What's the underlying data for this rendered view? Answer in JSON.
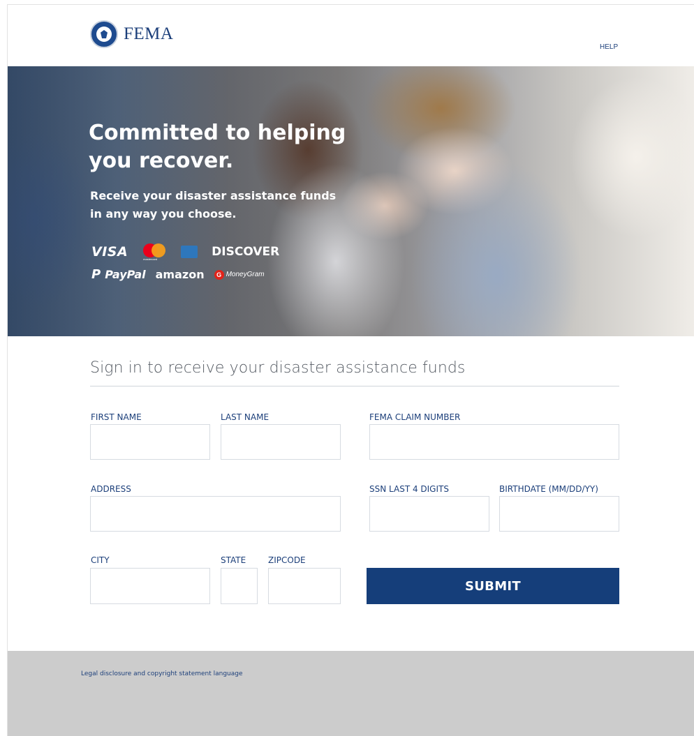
{
  "header": {
    "brand": "FEMA",
    "help_label": "HELP"
  },
  "hero": {
    "title": "Committed to helping you recover.",
    "subtitle": "Receive your disaster assistance funds in any way you choose.",
    "payment_methods": {
      "visa": "VISA",
      "mastercard": "mastercard",
      "discover": "DISCOVER",
      "paypal": "PayPal",
      "amazon": "amazon",
      "moneygram": "MoneyGram"
    }
  },
  "form": {
    "title": "Sign in to receive your disaster assistance funds",
    "fields": {
      "first_name": {
        "label": "FIRST NAME",
        "value": ""
      },
      "last_name": {
        "label": "LAST NAME",
        "value": ""
      },
      "claim_number": {
        "label": "FEMA CLAIM NUMBER",
        "value": ""
      },
      "address": {
        "label": "ADDRESS",
        "value": ""
      },
      "ssn_last4": {
        "label": "SSN LAST 4 DIGITS",
        "value": ""
      },
      "birthdate": {
        "label": "BIRTHDATE (MM/DD/YY)",
        "value": ""
      },
      "city": {
        "label": "CITY",
        "value": ""
      },
      "state": {
        "label": "STATE",
        "value": ""
      },
      "zipcode": {
        "label": "ZIPCODE",
        "value": ""
      }
    },
    "submit_label": "SUBMIT"
  },
  "footer": {
    "legal_text": "Legal disclosure and copyright statement language"
  },
  "colors": {
    "brand_blue": "#153e7a",
    "label_blue": "#1c3f7a",
    "footer_gray": "#cccccc",
    "input_border": "#d6dbe1"
  }
}
